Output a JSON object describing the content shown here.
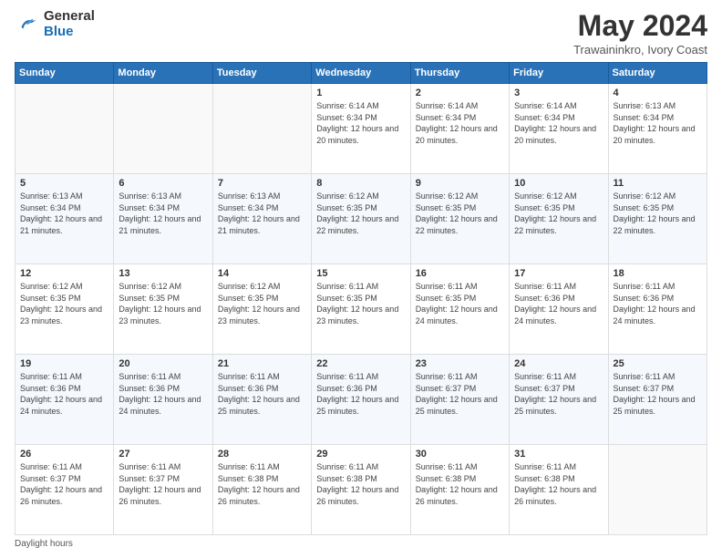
{
  "header": {
    "logo_line1": "General",
    "logo_line2": "Blue",
    "title": "May 2024",
    "subtitle": "Trawaininkro, Ivory Coast"
  },
  "days_of_week": [
    "Sunday",
    "Monday",
    "Tuesday",
    "Wednesday",
    "Thursday",
    "Friday",
    "Saturday"
  ],
  "weeks": [
    [
      {
        "day": "",
        "info": ""
      },
      {
        "day": "",
        "info": ""
      },
      {
        "day": "",
        "info": ""
      },
      {
        "day": "1",
        "info": "Sunrise: 6:14 AM\nSunset: 6:34 PM\nDaylight: 12 hours\nand 20 minutes."
      },
      {
        "day": "2",
        "info": "Sunrise: 6:14 AM\nSunset: 6:34 PM\nDaylight: 12 hours\nand 20 minutes."
      },
      {
        "day": "3",
        "info": "Sunrise: 6:14 AM\nSunset: 6:34 PM\nDaylight: 12 hours\nand 20 minutes."
      },
      {
        "day": "4",
        "info": "Sunrise: 6:13 AM\nSunset: 6:34 PM\nDaylight: 12 hours\nand 20 minutes."
      }
    ],
    [
      {
        "day": "5",
        "info": "Sunrise: 6:13 AM\nSunset: 6:34 PM\nDaylight: 12 hours\nand 21 minutes."
      },
      {
        "day": "6",
        "info": "Sunrise: 6:13 AM\nSunset: 6:34 PM\nDaylight: 12 hours\nand 21 minutes."
      },
      {
        "day": "7",
        "info": "Sunrise: 6:13 AM\nSunset: 6:34 PM\nDaylight: 12 hours\nand 21 minutes."
      },
      {
        "day": "8",
        "info": "Sunrise: 6:12 AM\nSunset: 6:35 PM\nDaylight: 12 hours\nand 22 minutes."
      },
      {
        "day": "9",
        "info": "Sunrise: 6:12 AM\nSunset: 6:35 PM\nDaylight: 12 hours\nand 22 minutes."
      },
      {
        "day": "10",
        "info": "Sunrise: 6:12 AM\nSunset: 6:35 PM\nDaylight: 12 hours\nand 22 minutes."
      },
      {
        "day": "11",
        "info": "Sunrise: 6:12 AM\nSunset: 6:35 PM\nDaylight: 12 hours\nand 22 minutes."
      }
    ],
    [
      {
        "day": "12",
        "info": "Sunrise: 6:12 AM\nSunset: 6:35 PM\nDaylight: 12 hours\nand 23 minutes."
      },
      {
        "day": "13",
        "info": "Sunrise: 6:12 AM\nSunset: 6:35 PM\nDaylight: 12 hours\nand 23 minutes."
      },
      {
        "day": "14",
        "info": "Sunrise: 6:12 AM\nSunset: 6:35 PM\nDaylight: 12 hours\nand 23 minutes."
      },
      {
        "day": "15",
        "info": "Sunrise: 6:11 AM\nSunset: 6:35 PM\nDaylight: 12 hours\nand 23 minutes."
      },
      {
        "day": "16",
        "info": "Sunrise: 6:11 AM\nSunset: 6:35 PM\nDaylight: 12 hours\nand 24 minutes."
      },
      {
        "day": "17",
        "info": "Sunrise: 6:11 AM\nSunset: 6:36 PM\nDaylight: 12 hours\nand 24 minutes."
      },
      {
        "day": "18",
        "info": "Sunrise: 6:11 AM\nSunset: 6:36 PM\nDaylight: 12 hours\nand 24 minutes."
      }
    ],
    [
      {
        "day": "19",
        "info": "Sunrise: 6:11 AM\nSunset: 6:36 PM\nDaylight: 12 hours\nand 24 minutes."
      },
      {
        "day": "20",
        "info": "Sunrise: 6:11 AM\nSunset: 6:36 PM\nDaylight: 12 hours\nand 24 minutes."
      },
      {
        "day": "21",
        "info": "Sunrise: 6:11 AM\nSunset: 6:36 PM\nDaylight: 12 hours\nand 25 minutes."
      },
      {
        "day": "22",
        "info": "Sunrise: 6:11 AM\nSunset: 6:36 PM\nDaylight: 12 hours\nand 25 minutes."
      },
      {
        "day": "23",
        "info": "Sunrise: 6:11 AM\nSunset: 6:37 PM\nDaylight: 12 hours\nand 25 minutes."
      },
      {
        "day": "24",
        "info": "Sunrise: 6:11 AM\nSunset: 6:37 PM\nDaylight: 12 hours\nand 25 minutes."
      },
      {
        "day": "25",
        "info": "Sunrise: 6:11 AM\nSunset: 6:37 PM\nDaylight: 12 hours\nand 25 minutes."
      }
    ],
    [
      {
        "day": "26",
        "info": "Sunrise: 6:11 AM\nSunset: 6:37 PM\nDaylight: 12 hours\nand 26 minutes."
      },
      {
        "day": "27",
        "info": "Sunrise: 6:11 AM\nSunset: 6:37 PM\nDaylight: 12 hours\nand 26 minutes."
      },
      {
        "day": "28",
        "info": "Sunrise: 6:11 AM\nSunset: 6:38 PM\nDaylight: 12 hours\nand 26 minutes."
      },
      {
        "day": "29",
        "info": "Sunrise: 6:11 AM\nSunset: 6:38 PM\nDaylight: 12 hours\nand 26 minutes."
      },
      {
        "day": "30",
        "info": "Sunrise: 6:11 AM\nSunset: 6:38 PM\nDaylight: 12 hours\nand 26 minutes."
      },
      {
        "day": "31",
        "info": "Sunrise: 6:11 AM\nSunset: 6:38 PM\nDaylight: 12 hours\nand 26 minutes."
      },
      {
        "day": "",
        "info": ""
      }
    ]
  ],
  "footer": {
    "note": "Daylight hours"
  }
}
